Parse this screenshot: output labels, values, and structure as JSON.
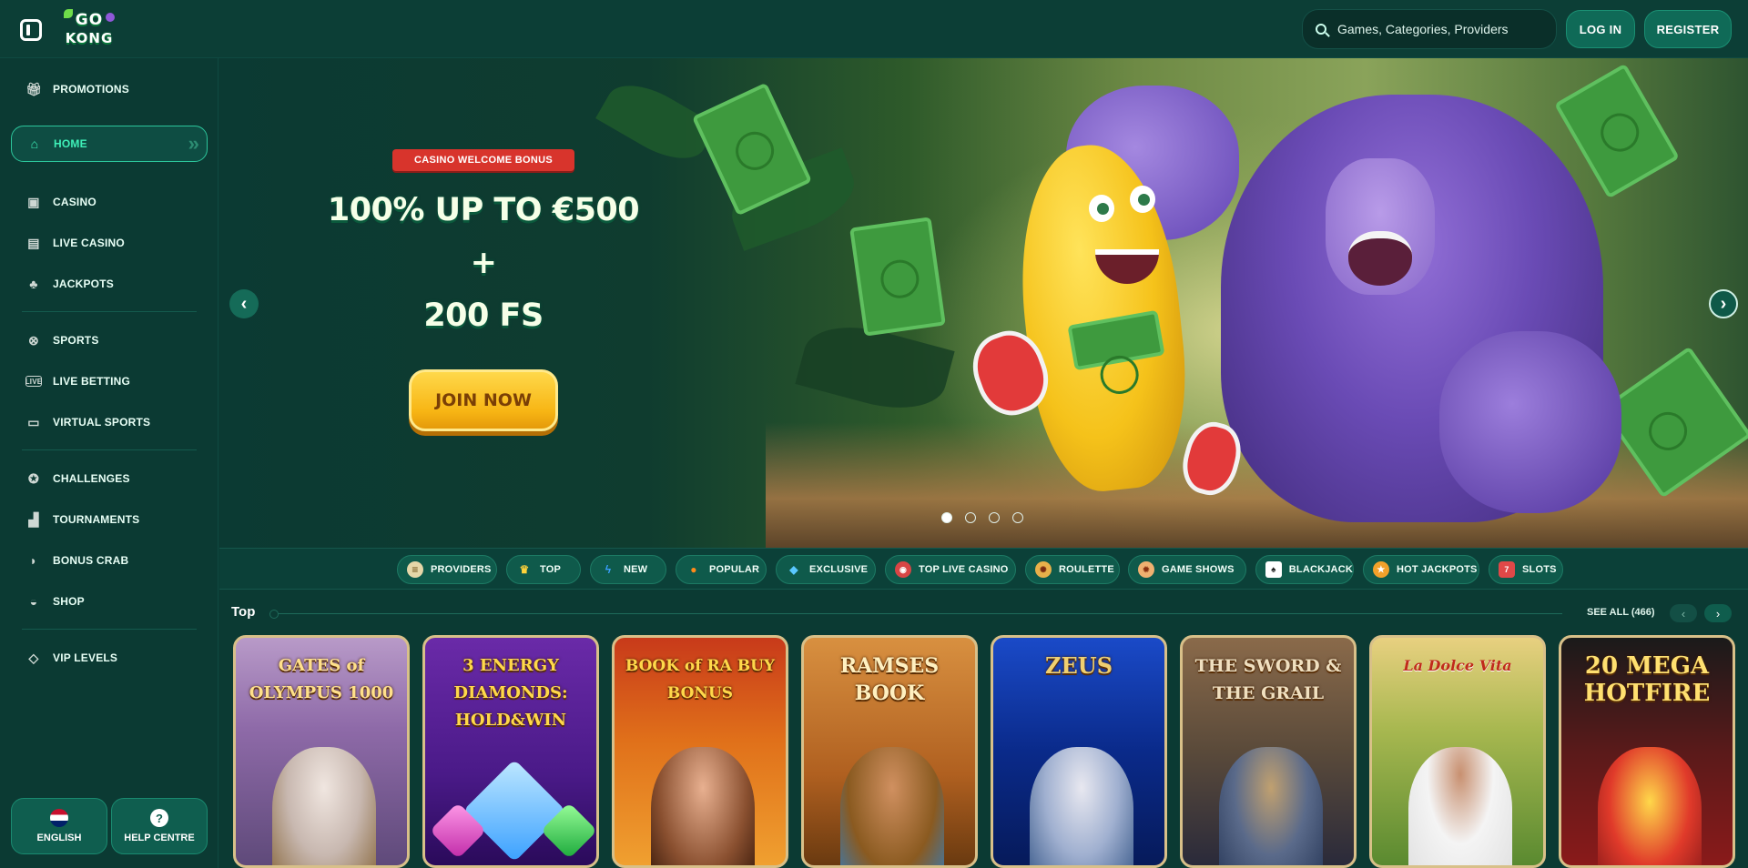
{
  "header": {
    "logo_text_top": "GO",
    "logo_text_bottom": "KONG",
    "search_placeholder": "Games, Categories, Providers",
    "login_label": "LOG IN",
    "register_label": "REGISTER"
  },
  "sidebar": {
    "items": [
      {
        "label": "PROMOTIONS",
        "icon": "gift-icon"
      },
      {
        "label": "HOME",
        "icon": "home-icon",
        "active": true
      },
      {
        "label": "CASINO",
        "icon": "slot-machine-icon"
      },
      {
        "label": "LIVE CASINO",
        "icon": "cards-icon"
      },
      {
        "label": "JACKPOTS",
        "icon": "clover-icon"
      },
      {
        "label": "SPORTS",
        "icon": "ball-icon"
      },
      {
        "label": "LIVE BETTING",
        "icon": "live-icon"
      },
      {
        "label": "VIRTUAL SPORTS",
        "icon": "monitor-icon"
      },
      {
        "label": "CHALLENGES",
        "icon": "medal-icon"
      },
      {
        "label": "TOURNAMENTS",
        "icon": "podium-icon"
      },
      {
        "label": "BONUS CRAB",
        "icon": "claw-icon"
      },
      {
        "label": "SHOP",
        "icon": "basket-icon"
      },
      {
        "label": "VIP LEVELS",
        "icon": "diamond-icon"
      }
    ],
    "language_label": "ENGLISH",
    "help_label": "HELP CENTRE"
  },
  "hero": {
    "ribbon": "CASINO WELCOME BONUS",
    "headline_line1": "100% UP TO €500 +",
    "headline_line2": "200 FS",
    "cta_label": "JOIN NOW",
    "slide_count": 4,
    "active_slide": 1
  },
  "categories": [
    {
      "label": "PROVIDERS",
      "icon": "scroll-icon"
    },
    {
      "label": "TOP",
      "icon": "crown-icon"
    },
    {
      "label": "NEW",
      "icon": "lightning-icon"
    },
    {
      "label": "POPULAR",
      "icon": "fire-icon"
    },
    {
      "label": "EXCLUSIVE",
      "icon": "diamond-icon"
    },
    {
      "label": "TOP LIVE CASINO",
      "icon": "chip-icon"
    },
    {
      "label": "ROULETTE",
      "icon": "roulette-icon"
    },
    {
      "label": "GAME SHOWS",
      "icon": "wheel-icon"
    },
    {
      "label": "BLACKJACK",
      "icon": "cards-icon"
    },
    {
      "label": "HOT JACKPOTS",
      "icon": "jackpot-icon"
    },
    {
      "label": "SLOTS",
      "icon": "slot-icon"
    }
  ],
  "games_section": {
    "title": "Top",
    "see_all": "SEE ALL (466)",
    "games": [
      {
        "title": "GATES of OLYMPUS 1000"
      },
      {
        "title": "3 ENERGY DIAMONDS: HOLD&WIN"
      },
      {
        "title": "BOOK of RA BUY BONUS"
      },
      {
        "title": "RAMSES BOOK"
      },
      {
        "title": "ZEUS"
      },
      {
        "title": "THE SWORD & THE GRAIL"
      },
      {
        "title": "La Dolce Vita"
      },
      {
        "title": "20 MEGA HOTFIRE"
      }
    ]
  },
  "colors": {
    "background": "#0b3a33",
    "accent": "#3ff0b8",
    "cta": "#f7b514",
    "ribbon": "#d8342c"
  }
}
